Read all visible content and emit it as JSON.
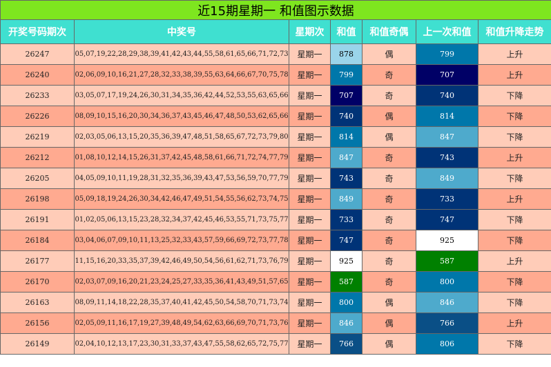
{
  "title": "近15期星期一 和值图示数据",
  "headers": [
    "开奖号码期次",
    "中奖号",
    "星期次",
    "和值",
    "和值奇偶",
    "上一次和值",
    "和值升降走势"
  ],
  "colors": {
    "title_bg": "#7ee61f",
    "header_bg": "#3fe0d0",
    "row_light": "#ffccb8",
    "row_dark": "#ffaa90",
    "sum_scale": {
      "white": "#ffffff",
      "green": "#008000",
      "navy": "#000066",
      "dark_blue": "#003377",
      "blue": "#0077aa",
      "light_blue": "#4eaacc",
      "pale_blue": "#9ad4ea"
    }
  },
  "rows": [
    {
      "period": "26247",
      "numbers": "05,07,19,22,28,29,38,39,41,42,43,44,55,58,61,65,66,71,72,73",
      "week": "星期一",
      "sum": "878",
      "parity": "偶",
      "prev_sum": "799",
      "trend": "上升",
      "sum_color": "#9ad4ea",
      "sum_text": "#000000",
      "prev_color": "#0077aa",
      "prev_text": "#ffffff"
    },
    {
      "period": "26240",
      "numbers": "02,06,09,10,16,21,27,28,32,33,38,39,55,63,64,66,67,70,75,78",
      "week": "星期一",
      "sum": "799",
      "parity": "奇",
      "prev_sum": "707",
      "trend": "上升",
      "sum_color": "#0077aa",
      "sum_text": "#ffffff",
      "prev_color": "#000066",
      "prev_text": "#ffffff"
    },
    {
      "period": "26233",
      "numbers": "03,05,07,17,19,24,26,30,31,34,35,36,42,44,52,53,55,63,65,66",
      "week": "星期一",
      "sum": "707",
      "parity": "奇",
      "prev_sum": "740",
      "trend": "下降",
      "sum_color": "#000066",
      "sum_text": "#ffffff",
      "prev_color": "#003377",
      "prev_text": "#ffffff"
    },
    {
      "period": "26226",
      "numbers": "08,09,10,15,16,20,30,34,36,37,43,45,46,47,48,50,53,62,65,66",
      "week": "星期一",
      "sum": "740",
      "parity": "偶",
      "prev_sum": "814",
      "trend": "下降",
      "sum_color": "#003377",
      "sum_text": "#ffffff",
      "prev_color": "#0077aa",
      "prev_text": "#ffffff"
    },
    {
      "period": "26219",
      "numbers": "02,03,05,06,13,15,20,35,36,39,47,48,51,58,65,67,72,73,79,80",
      "week": "星期一",
      "sum": "814",
      "parity": "偶",
      "prev_sum": "847",
      "trend": "下降",
      "sum_color": "#0077aa",
      "sum_text": "#ffffff",
      "prev_color": "#4eaacc",
      "prev_text": "#ffffff"
    },
    {
      "period": "26212",
      "numbers": "01,08,10,12,14,15,26,31,37,42,45,48,58,61,66,71,72,74,77,79",
      "week": "星期一",
      "sum": "847",
      "parity": "奇",
      "prev_sum": "743",
      "trend": "上升",
      "sum_color": "#4eaacc",
      "sum_text": "#ffffff",
      "prev_color": "#003377",
      "prev_text": "#ffffff"
    },
    {
      "period": "26205",
      "numbers": "04,05,09,10,11,19,28,31,32,35,36,39,43,47,53,56,59,70,77,79",
      "week": "星期一",
      "sum": "743",
      "parity": "奇",
      "prev_sum": "849",
      "trend": "下降",
      "sum_color": "#003377",
      "sum_text": "#ffffff",
      "prev_color": "#4eaacc",
      "prev_text": "#ffffff"
    },
    {
      "period": "26198",
      "numbers": "05,09,18,19,24,26,30,34,42,46,47,49,51,54,55,56,62,73,74,75",
      "week": "星期一",
      "sum": "849",
      "parity": "奇",
      "prev_sum": "733",
      "trend": "上升",
      "sum_color": "#4eaacc",
      "sum_text": "#ffffff",
      "prev_color": "#003377",
      "prev_text": "#ffffff"
    },
    {
      "period": "26191",
      "numbers": "01,02,05,06,13,15,23,28,32,34,37,42,45,46,53,55,71,73,75,77",
      "week": "星期一",
      "sum": "733",
      "parity": "奇",
      "prev_sum": "747",
      "trend": "下降",
      "sum_color": "#003377",
      "sum_text": "#ffffff",
      "prev_color": "#003377",
      "prev_text": "#ffffff"
    },
    {
      "period": "26184",
      "numbers": "03,04,06,07,09,10,11,13,25,32,33,43,57,59,66,69,72,73,77,78",
      "week": "星期一",
      "sum": "747",
      "parity": "奇",
      "prev_sum": "925",
      "trend": "下降",
      "sum_color": "#003377",
      "sum_text": "#ffffff",
      "prev_color": "#ffffff",
      "prev_text": "#000000"
    },
    {
      "period": "26177",
      "numbers": "11,15,16,20,33,35,37,39,42,46,49,50,54,56,61,62,71,73,76,79",
      "week": "星期一",
      "sum": "925",
      "parity": "奇",
      "prev_sum": "587",
      "trend": "上升",
      "sum_color": "#ffffff",
      "sum_text": "#000000",
      "prev_color": "#008000",
      "prev_text": "#ffffff"
    },
    {
      "period": "26170",
      "numbers": "02,03,07,09,16,20,21,23,24,25,27,33,35,36,41,43,49,51,57,65",
      "week": "星期一",
      "sum": "587",
      "parity": "奇",
      "prev_sum": "800",
      "trend": "下降",
      "sum_color": "#008000",
      "sum_text": "#ffffff",
      "prev_color": "#0077aa",
      "prev_text": "#ffffff"
    },
    {
      "period": "26163",
      "numbers": "08,09,11,14,18,22,28,35,37,40,41,42,45,50,54,58,70,71,73,74",
      "week": "星期一",
      "sum": "800",
      "parity": "偶",
      "prev_sum": "846",
      "trend": "下降",
      "sum_color": "#0077aa",
      "sum_text": "#ffffff",
      "prev_color": "#4eaacc",
      "prev_text": "#ffffff"
    },
    {
      "period": "26156",
      "numbers": "02,05,09,11,16,17,19,27,39,48,49,54,62,63,66,69,70,71,73,76",
      "week": "星期一",
      "sum": "846",
      "parity": "偶",
      "prev_sum": "766",
      "trend": "上升",
      "sum_color": "#4eaacc",
      "sum_text": "#ffffff",
      "prev_color": "#0a4f86",
      "prev_text": "#ffffff"
    },
    {
      "period": "26149",
      "numbers": "02,04,10,12,13,17,23,30,31,33,37,43,47,55,58,62,65,72,75,77",
      "week": "星期一",
      "sum": "766",
      "parity": "偶",
      "prev_sum": "806",
      "trend": "下降",
      "sum_color": "#0a4f86",
      "sum_text": "#ffffff",
      "prev_color": "#0077aa",
      "prev_text": "#ffffff"
    }
  ]
}
